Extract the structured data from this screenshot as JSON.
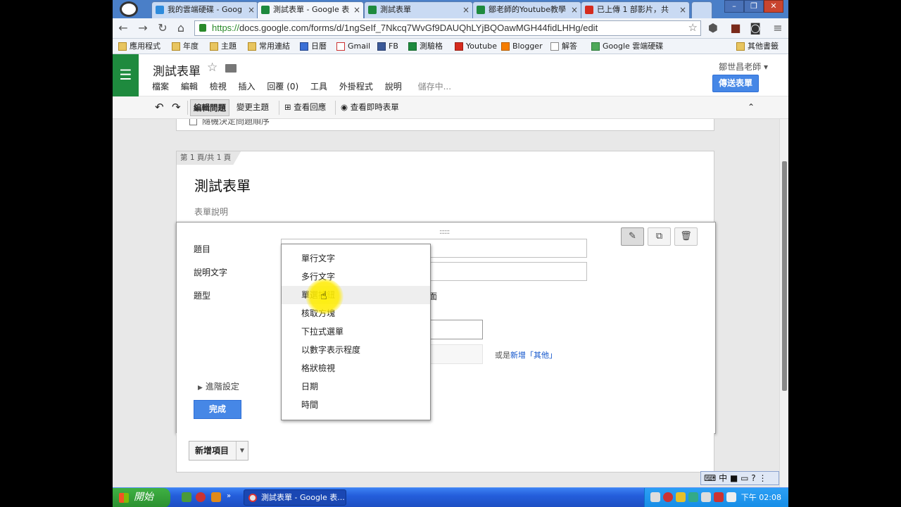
{
  "browser": {
    "tabs": [
      {
        "label": "我的雲端硬碟 - Goog",
        "color": "#2e8bdc"
      },
      {
        "label": "測試表單 - Google 表",
        "color": "#1e8a3e"
      },
      {
        "label": "測試表單",
        "color": "#1e8a3e"
      },
      {
        "label": "鄒老師的Youtube教學",
        "color": "#1e8a3e"
      },
      {
        "label": "已上傳 1 部影片，共",
        "color": "#d52b1e"
      }
    ],
    "close_glyph": "×",
    "url_scheme": "https://",
    "url_rest": "docs.google.com/forms/d/1ngSeIf_7Nkcq7WvGf9DAUQhLYjBQOawMGH44fidLHHg/edit",
    "bookmarks": [
      "應用程式",
      "年度",
      "主題",
      "常用連結",
      "日曆",
      "Gmail",
      "FB",
      "測驗格",
      "Youtube",
      "Blogger",
      "解答",
      "Google 雲端硬碟",
      "其他書籤"
    ]
  },
  "docs": {
    "title": "測試表單",
    "menu": [
      "檔案",
      "編輯",
      "檢視",
      "插入",
      "回覆 (0)",
      "工具",
      "外掛程式",
      "說明"
    ],
    "saving": "儲存中...",
    "user": "鄒世昌老師 ▾",
    "send_button": "傳送表單"
  },
  "editor_toolbar": {
    "edit_questions": "編輯問題",
    "change_theme": "變更主題",
    "view_responses": "查看回應",
    "view_live_form": "查看即時表單"
  },
  "form": {
    "prev_card_text": "隨機決定問題順序",
    "page_label": "第 1 頁/共 1 頁",
    "title": "測試表單",
    "description": "表單說明"
  },
  "question": {
    "label_title": "題目",
    "label_help": "說明文字",
    "label_type": "題型",
    "type_trailing": "面",
    "add_other_prefix": "或是",
    "add_other_link": "新增「其他」",
    "advanced": "進階設定",
    "done": "完成"
  },
  "type_menu": {
    "items": [
      "單行文字",
      "多行文字",
      "單選按鈕",
      "核取方塊",
      "下拉式選單",
      "以數字表示程度",
      "格狀檢視",
      "日期",
      "時間"
    ],
    "highlighted_index": 2
  },
  "add_item": "新增項目",
  "taskbar": {
    "start": "開始",
    "app": "測試表單 - Google 表...",
    "clock": "下午 02:08",
    "lang": "中"
  }
}
